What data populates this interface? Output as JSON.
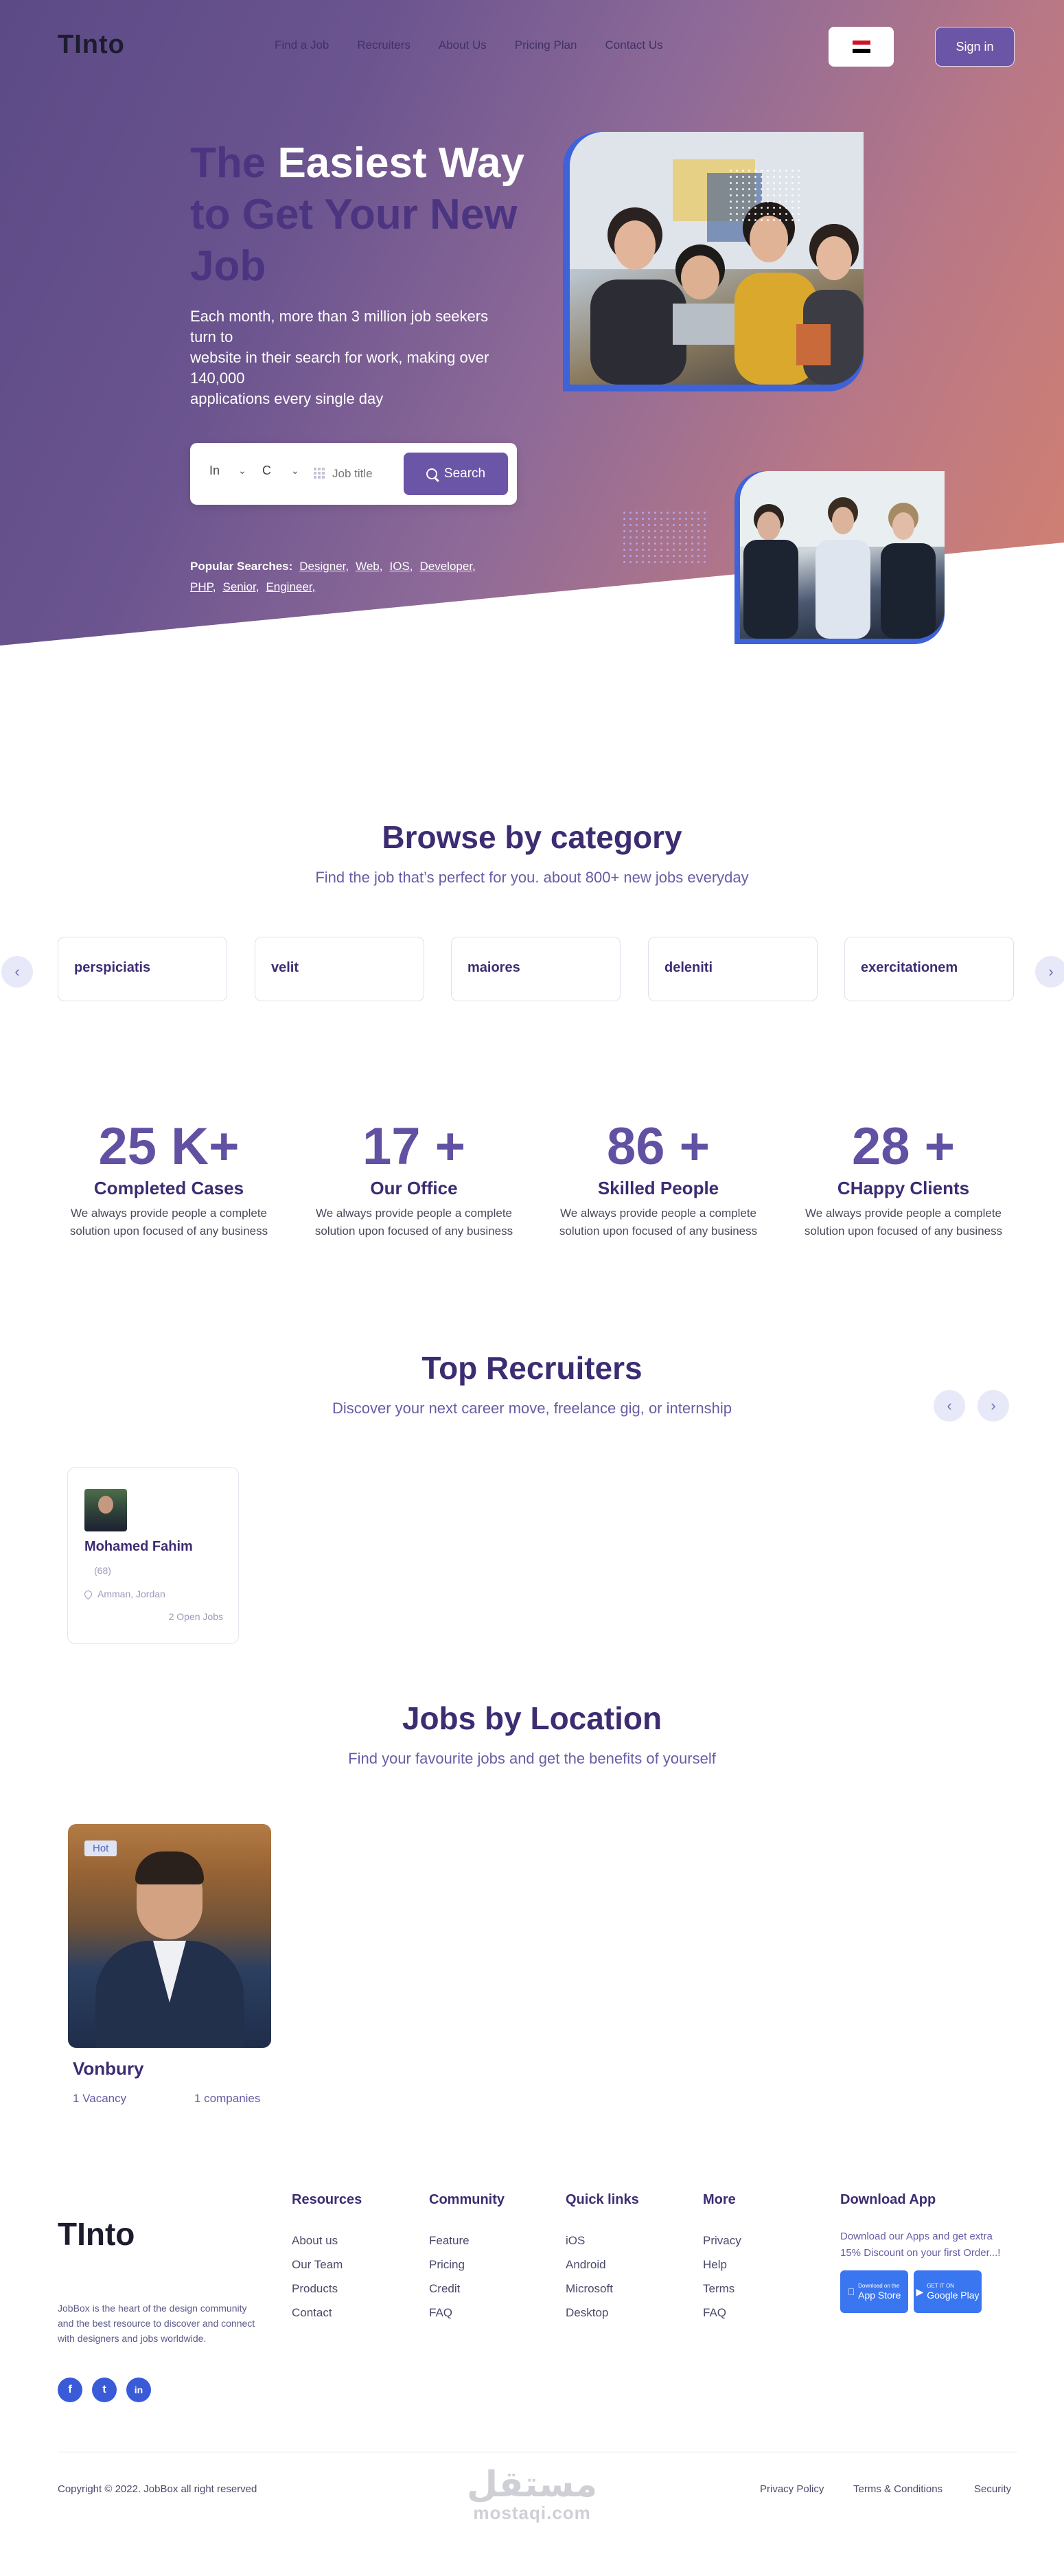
{
  "header": {
    "logo": "TInto",
    "nav": [
      "Find a Job",
      "Recruiters",
      "About Us",
      "Pricing Plan",
      "Contact Us"
    ],
    "signin_label": "Sign in",
    "flag_colors": [
      "#ce1126",
      "#ffffff",
      "#000000"
    ]
  },
  "hero": {
    "title_the": "The ",
    "title_easiest": "Easiest Way",
    "title_rest": "to Get Your New Job",
    "subtitle_lines": [
      "Each month, more than 3 million job seekers",
      "turn to",
      "website in their search for work, making over",
      "140,000",
      "applications every single day"
    ],
    "search": {
      "select1": "In",
      "select2": "C",
      "job_placeholder": "Job title",
      "button_label": "Search"
    },
    "popular_label": "Popular Searches:",
    "popular_tags": [
      "Designer,",
      "Web,",
      "IOS,",
      "Developer,",
      "PHP,",
      "Senior,",
      "Engineer,"
    ]
  },
  "categories": {
    "title": "Browse by category",
    "subtitle": "Find the job that’s perfect for you. about 800+ new jobs everyday",
    "items": [
      "perspiciatis",
      "velit",
      "maiores",
      "deleniti",
      "exercitationem"
    ],
    "prev_icon": "‹",
    "next_icon": "›"
  },
  "stats": [
    {
      "number": "25 K+",
      "label": "Completed Cases",
      "desc": "We always provide people a complete solution upon focused of any business"
    },
    {
      "number": "17 +",
      "label": "Our Office",
      "desc": "We always provide people a complete solution upon focused of any business"
    },
    {
      "number": "86 +",
      "label": "Skilled People",
      "desc": "We always provide people a complete solution upon focused of any business"
    },
    {
      "number": "28 +",
      "label": "CHappy Clients",
      "desc": "We always provide people a complete solution upon focused of any business"
    }
  ],
  "recruiters": {
    "title": "Top Recruiters",
    "subtitle": "Discover your next career move, freelance gig, or internship",
    "prev_icon": "‹",
    "next_icon": "›",
    "items": [
      {
        "name": "Mohamed Fahim",
        "count": "(68)",
        "location": "Amman, Jordan",
        "open_jobs": "2 Open Jobs"
      }
    ]
  },
  "locations": {
    "title": "Jobs by Location",
    "subtitle": "Find your favourite jobs and get the benefits of yourself",
    "items": [
      {
        "badge": "Hot",
        "name": "Vonbury",
        "vacancy": "1 Vacancy",
        "companies": "1 companies"
      }
    ]
  },
  "footer": {
    "logo": "TInto",
    "about": "JobBox is the heart of the design community and the best resource to discover and connect with designers and jobs worldwide.",
    "social": [
      "f",
      "t",
      "in"
    ],
    "columns": [
      {
        "title": "Resources",
        "links": [
          "About us",
          "Our Team",
          "Products",
          "Contact"
        ]
      },
      {
        "title": "Community",
        "links": [
          "Feature",
          "Pricing",
          "Credit",
          "FAQ"
        ]
      },
      {
        "title": "Quick links",
        "links": [
          "iOS",
          "Android",
          "Microsoft",
          "Desktop"
        ]
      },
      {
        "title": "More",
        "links": [
          "Privacy",
          "Help",
          "Terms",
          "FAQ"
        ]
      }
    ],
    "download": {
      "title": "Download App",
      "text": "Download our Apps and get extra 15% Discount on your first Order...!",
      "appstore_small": "Download on the",
      "appstore": "App Store",
      "googleplay_small": "GET IT ON",
      "googleplay": "Google Play"
    },
    "copyright": "Copyright © 2022. JobBox all right reserved",
    "bottom_links": [
      "Privacy Policy",
      "Terms & Conditions",
      "Security"
    ],
    "watermark_ar": "مستقل",
    "watermark_latin": "mostaqi.com"
  }
}
